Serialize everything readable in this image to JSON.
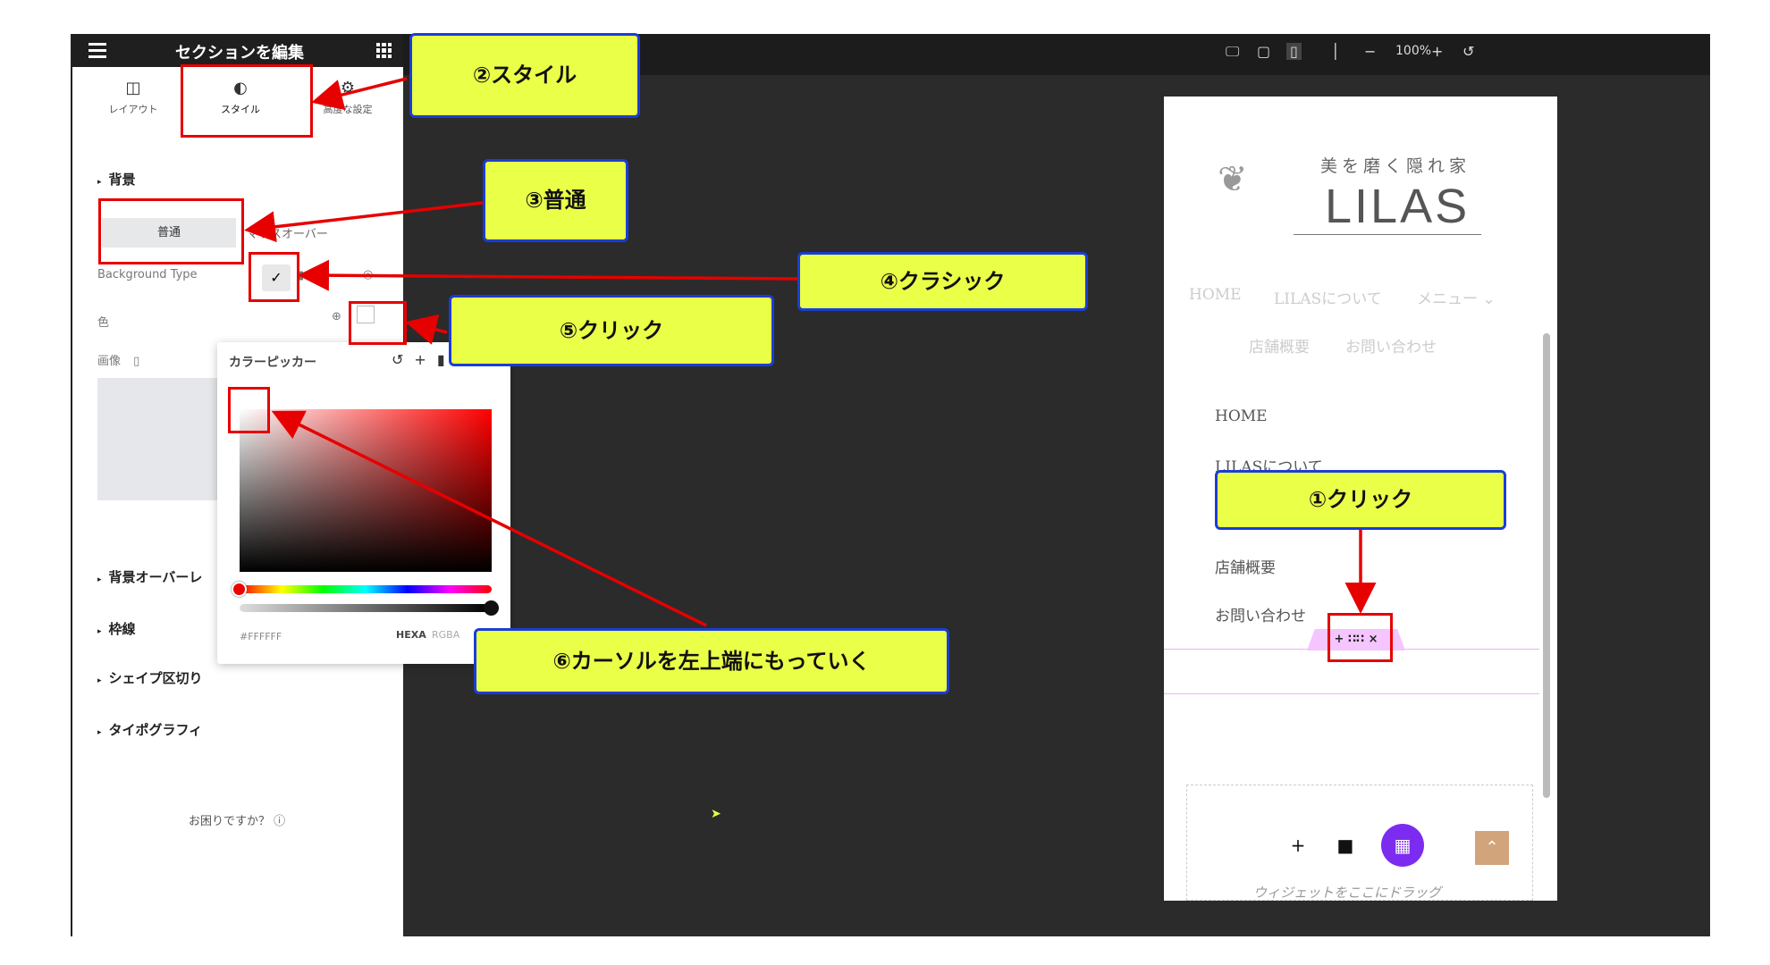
{
  "panel": {
    "title": "セクションを編集",
    "tabs": [
      {
        "label": "レイアウト",
        "icon": "layout-icon"
      },
      {
        "label": "スタイル",
        "icon": "style-icon"
      },
      {
        "label": "高度な設定",
        "icon": "gear-icon"
      }
    ],
    "sections": {
      "background": "背景",
      "overlay": "背景オーバーレ",
      "border": "枠線",
      "shape": "シェイプ区切り",
      "typography": "タイポグラフィ"
    },
    "normal_label": "普通",
    "hover_label": "マウスオーバー",
    "bg_type_label": "Background Type",
    "color_label": "色",
    "image_label": "画像",
    "help": "お困りですか？"
  },
  "picker": {
    "title": "カラーピッカー",
    "hex": "#FFFFFF",
    "mode_active": "HEXA",
    "mode_inactive": "RGBA"
  },
  "toolbar": {
    "zoom": "100%"
  },
  "preview": {
    "logo_sub": "美を磨く隠れ家",
    "logo": "LILAS",
    "nav_faint": [
      "HOME",
      "LILASについて",
      "メニュー ⌄",
      "店舗概要",
      "お問い合わせ"
    ],
    "nav_dark": [
      "HOME",
      "LILASについて",
      "店舗概要",
      "お問い合わせ"
    ],
    "section_handle": "+ ∷∷ ×",
    "drop_hint": "ウィジェットをここにドラッグ"
  },
  "callouts": {
    "c1": "①クリック",
    "c2": "②スタイル",
    "c3": "③普通",
    "c4": "④クラシック",
    "c5": "⑤クリック",
    "c6": "⑥カーソルを左上端にもっていく"
  },
  "colors": {
    "annotation_red": "#e60000",
    "callout_fill": "#eaff48",
    "callout_border": "#1a3ed6",
    "widget_purple": "#7c2cf0"
  }
}
